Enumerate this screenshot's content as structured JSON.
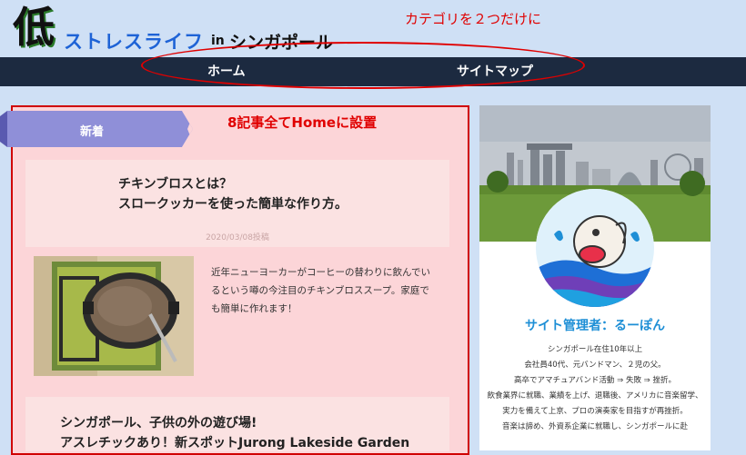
{
  "header": {
    "logo_kanji": "低",
    "logo_main": "ストレスライフ",
    "logo_in": "in",
    "logo_country": "シンガポール"
  },
  "annotations": {
    "top": "カテゴリを２つだけに",
    "main": "8記事全てHomeに設置"
  },
  "nav": {
    "items": [
      "ホーム",
      "サイトマップ"
    ]
  },
  "section": {
    "label": "新着"
  },
  "posts": [
    {
      "title_line1": "チキンブロスとは？",
      "title_line2": "スロークッカーを使った簡単な作り方。",
      "date": "2020/03/08投稿",
      "excerpt": "近年ニューヨーカーがコーヒーの替わりに飲んでいるという噂の今注目のチキンブロススープ。家庭でも簡単に作れます！"
    },
    {
      "title_line1": "シンガポール、子供の外の遊び場!",
      "title_line2": "アスレチックあり！新スポットJurong Lakeside Garden"
    }
  ],
  "sidebar": {
    "admin_name": "サイト管理者：るーぽん",
    "bio_lines": [
      "シンガポール在住10年以上",
      "会社員40代、元バンドマン、２児の父。",
      "高卒でアマチュアバンド活動 ⇒ 失敗 ⇒ 挫折。",
      "飲食業界に就職、業績を上げ、退職後、アメリカに音楽留学、",
      "実力を備えて上京、プロの演奏家を目指すが再挫折。",
      "音楽は諦め、外資系企業に就職し、シンガポールに赴"
    ]
  },
  "colors": {
    "nav_bg": "#1c2a40",
    "accent_blue": "#1e63d6",
    "annotation_red": "#e00000",
    "ribbon": "#8f8fd8"
  }
}
